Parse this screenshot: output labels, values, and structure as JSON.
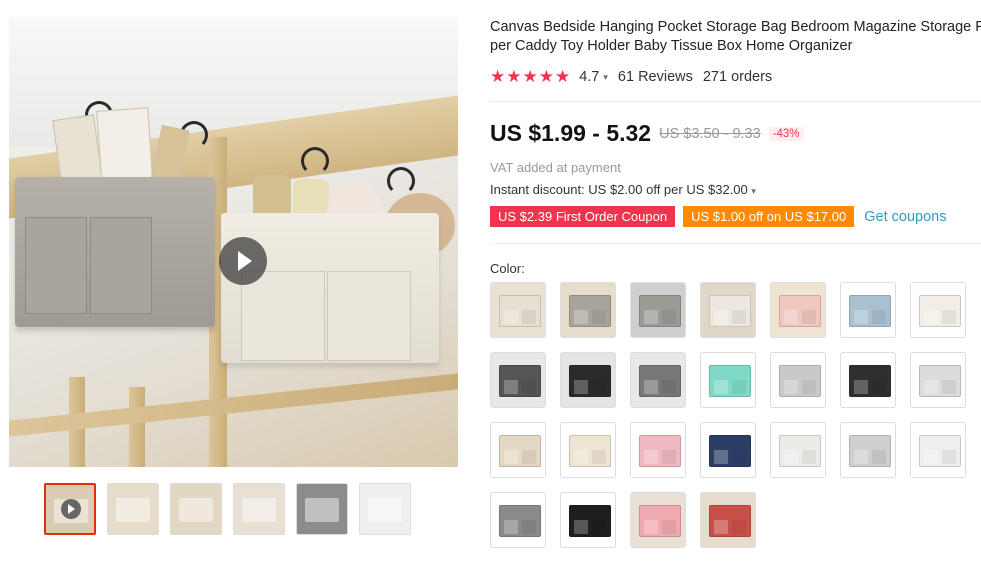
{
  "product": {
    "title_line1": "Canvas Bedside Hanging Pocket Storage Bag Bedroom Magazine Storage Po",
    "title_line2": "per Caddy Toy Holder Baby Tissue Box Home Organizer",
    "rating": "4.7",
    "reviews": "61 Reviews",
    "orders": "271 orders",
    "stars": "★★★★★"
  },
  "price": {
    "current": "US $1.99 - 5.32",
    "original": "US $3.50 - 9.33",
    "discount": "-43%",
    "vat_note": "VAT added at payment",
    "instant_discount": "Instant discount: US $2.00 off per US $32.00"
  },
  "coupons": {
    "first_order": "US $2.39 First Order Coupon",
    "store": "US $1.00 off on US $17.00",
    "get_coupons": "Get coupons"
  },
  "colors": {
    "label": "Color:",
    "options": [
      {
        "name": "beige-bag-on-bed",
        "bg": "#e9e2d3",
        "fg": "#e6e0d3"
      },
      {
        "name": "gray-bag-on-bed",
        "bg": "#e6ddcc",
        "fg": "#a8a49c"
      },
      {
        "name": "gray-bag-on-rail",
        "bg": "#cfcfcf",
        "fg": "#9c9a95"
      },
      {
        "name": "printed-bag-on-rail",
        "bg": "#dfd8c8",
        "fg": "#ece8df"
      },
      {
        "name": "pink-bag-on-bed",
        "bg": "#efe4d4",
        "fg": "#efc7bf"
      },
      {
        "name": "blue-bag",
        "bg": "#ffffff",
        "fg": "#a8c0cf"
      },
      {
        "name": "white-print-bag",
        "bg": "#ffffff",
        "fg": "#f2eee5"
      },
      {
        "name": "checkered-bag-a",
        "bg": "#e8e8e8",
        "fg": "#555555"
      },
      {
        "name": "black-grid-bag",
        "bg": "#e4e4e4",
        "fg": "#2b2b2b"
      },
      {
        "name": "checkered-bag-b",
        "bg": "#e8e8e8",
        "fg": "#777777"
      },
      {
        "name": "mint-bag",
        "bg": "#ffffff",
        "fg": "#7fd9c6"
      },
      {
        "name": "gray-print-bag",
        "bg": "#ffffff",
        "fg": "#c9c9c9"
      },
      {
        "name": "black-pattern-bag",
        "bg": "#ffffff",
        "fg": "#2f2f2f"
      },
      {
        "name": "white-pattern-bag",
        "bg": "#ffffff",
        "fg": "#dcdcdc"
      },
      {
        "name": "beige-diagram-bag",
        "bg": "#ffffff",
        "fg": "#e3d8c4"
      },
      {
        "name": "cream-print-bag",
        "bg": "#ffffff",
        "fg": "#ede4d2"
      },
      {
        "name": "pink-bag",
        "bg": "#ffffff",
        "fg": "#f0b8c0"
      },
      {
        "name": "navy-bag",
        "bg": "#ffffff",
        "fg": "#2d3e66"
      },
      {
        "name": "white-bag",
        "bg": "#ffffff",
        "fg": "#ecebe8"
      },
      {
        "name": "light-gray-bag",
        "bg": "#ffffff",
        "fg": "#cfcfcf"
      },
      {
        "name": "grid-white-bag",
        "bg": "#ffffff",
        "fg": "#eeeeee"
      },
      {
        "name": "gray-plaid-bag",
        "bg": "#ffffff",
        "fg": "#8a8a8a"
      },
      {
        "name": "black-plaid-bag",
        "bg": "#ffffff",
        "fg": "#1f1f1f"
      },
      {
        "name": "pink-bag-on-rail",
        "bg": "#e9e1d5",
        "fg": "#f0a9b0"
      },
      {
        "name": "red-bag-on-rail",
        "bg": "#e6dccd",
        "fg": "#c95048"
      }
    ]
  },
  "gallery": {
    "thumbnails": [
      {
        "name": "video-thumbnail",
        "bg": "#d9ccb3"
      },
      {
        "name": "bed-bags-thumbnail",
        "bg": "#e6dcc9"
      },
      {
        "name": "multi-bags-thumbnail",
        "bg": "#e2d7c2"
      },
      {
        "name": "hanging-bag-thumbnail",
        "bg": "#e8e1d3"
      },
      {
        "name": "black-bag-thumbnail",
        "bg": "#8c8c8c"
      },
      {
        "name": "gray-bag-thumbnail",
        "bg": "#efefef"
      }
    ]
  }
}
